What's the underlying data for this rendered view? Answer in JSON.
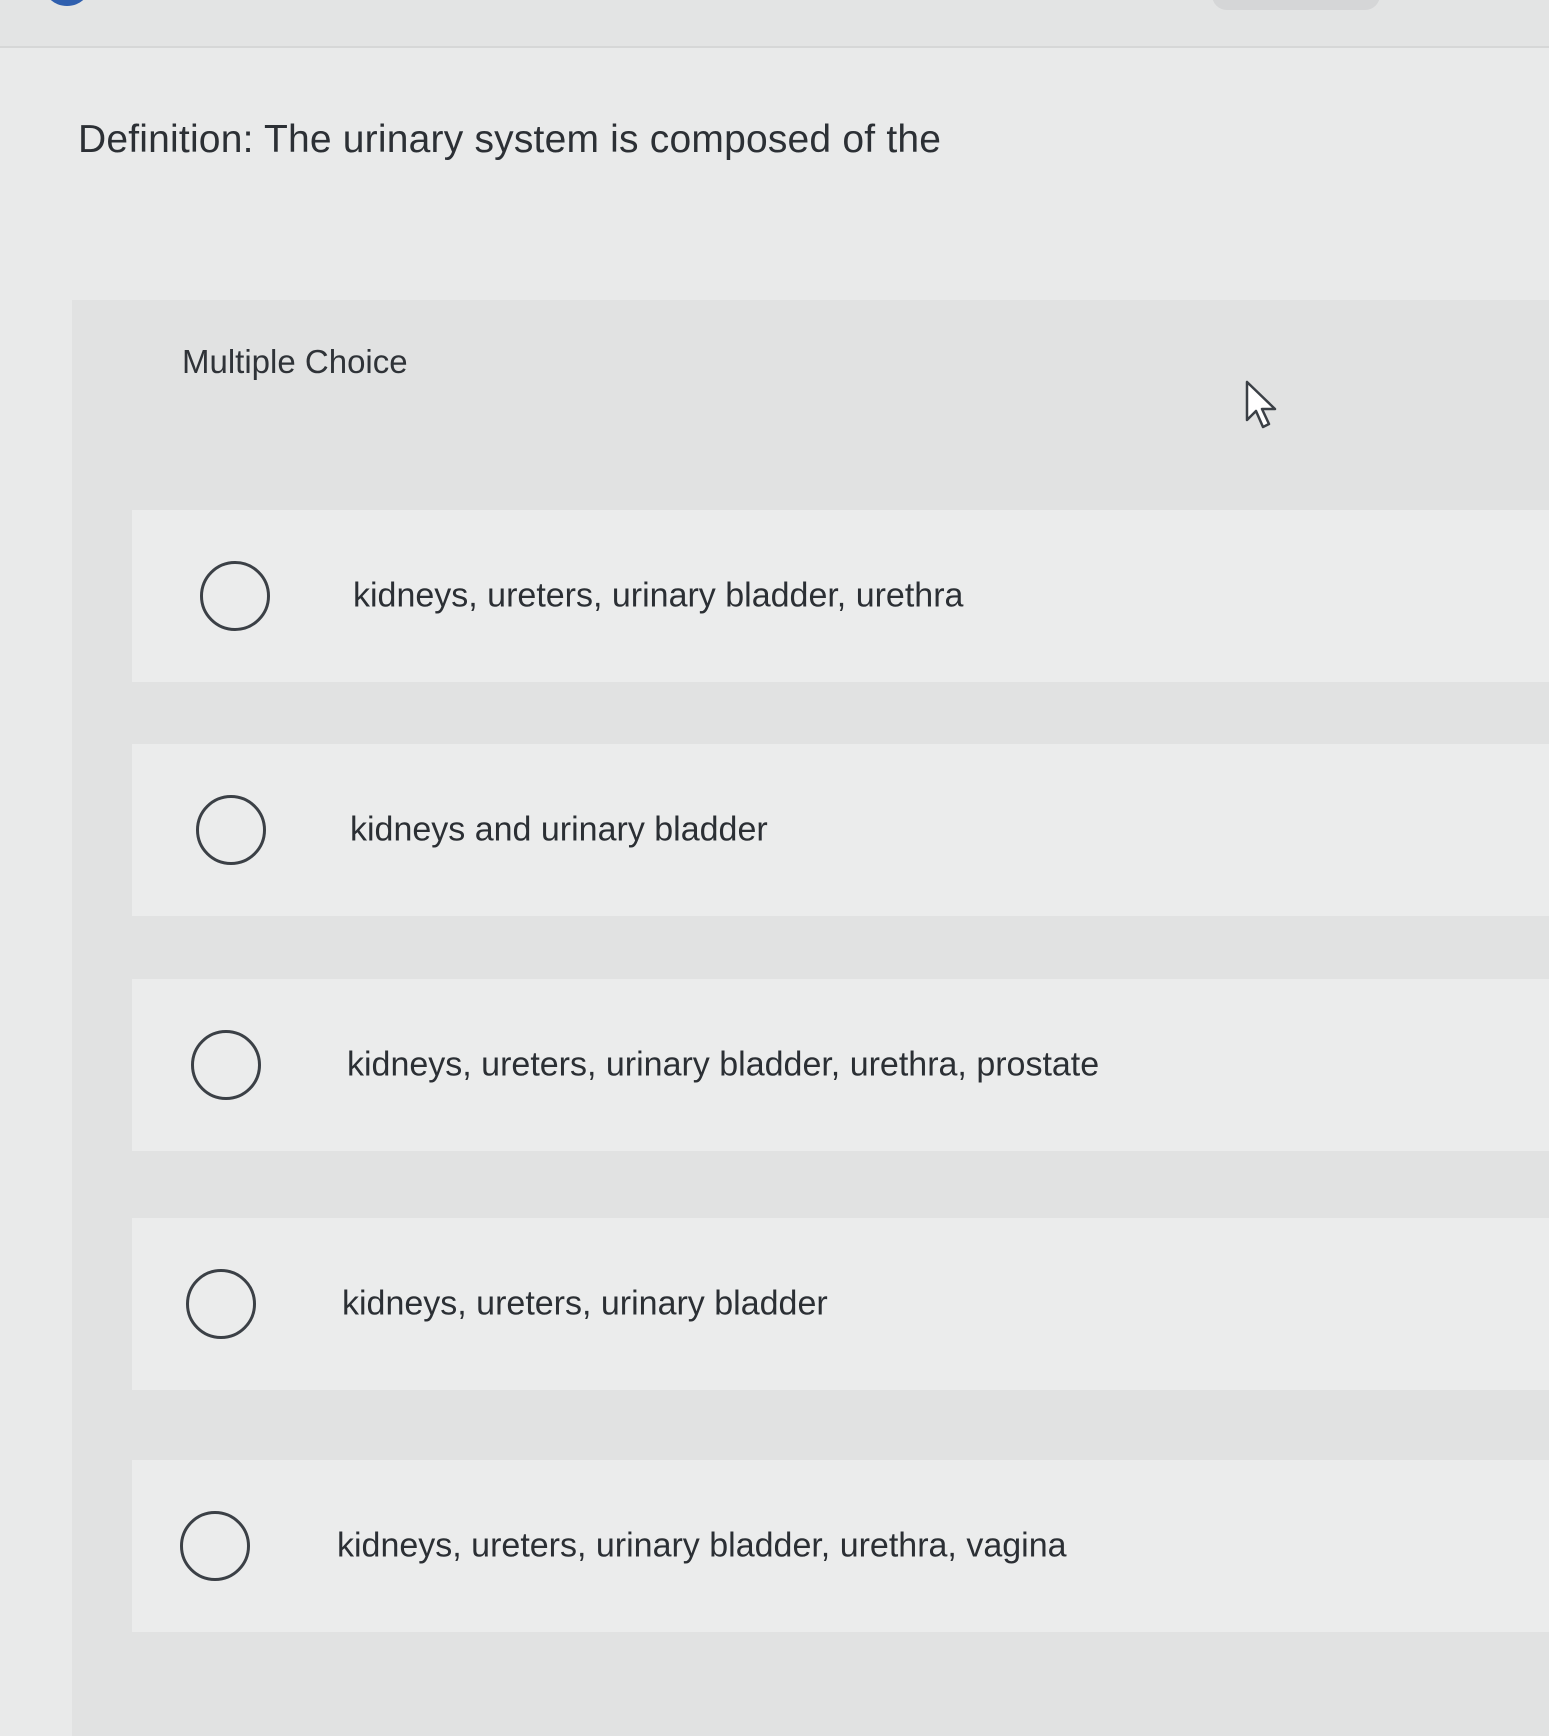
{
  "question": {
    "text": "Definition: The urinary system is composed of the"
  },
  "multiple_choice": {
    "label": "Multiple Choice",
    "options": [
      {
        "label": "kidneys, ureters, urinary bladder, urethra",
        "selected": false
      },
      {
        "label": "kidneys and urinary bladder",
        "selected": false
      },
      {
        "label": "kidneys, ureters, urinary bladder, urethra, prostate",
        "selected": false
      },
      {
        "label": "kidneys, ureters, urinary bladder",
        "selected": false
      },
      {
        "label": "kidneys, ureters, urinary bladder, urethra, vagina",
        "selected": false
      }
    ]
  },
  "icons": {
    "cursor": "mouse-pointer-icon",
    "radio": "radio-unselected-icon"
  },
  "colors": {
    "accent": "#2f5fae",
    "background": "#e9eaea",
    "panel": "#e1e2e2",
    "option_row": "#ebecec",
    "text": "#2b2f34"
  }
}
